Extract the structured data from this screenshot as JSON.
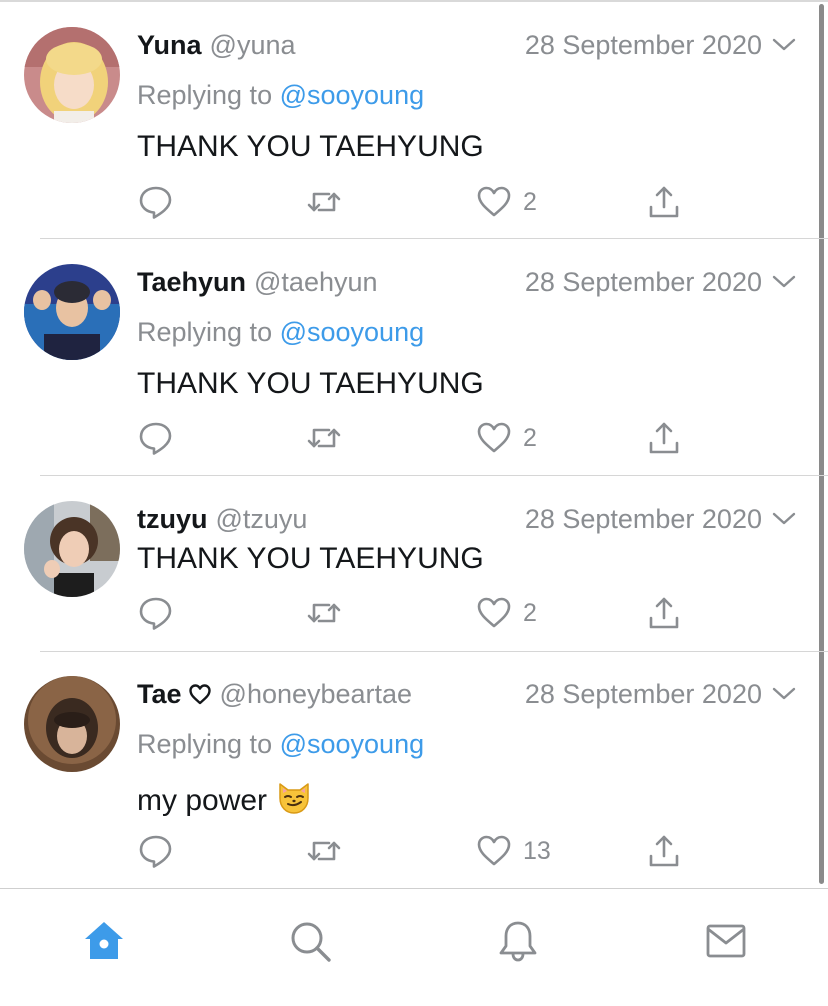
{
  "tweets": [
    {
      "name": "Yuna",
      "handle": "@yuna",
      "date": "28 September 2020",
      "replying_prefix": "Replying to ",
      "replying_to": "@sooyoung",
      "text": "THANK YOU TAEHYUNG",
      "likes": "2"
    },
    {
      "name": "Taehyun",
      "handle": "@taehyun",
      "date": "28 September 2020",
      "replying_prefix": "Replying to ",
      "replying_to": "@sooyoung",
      "text": "THANK YOU TAEHYUNG",
      "likes": "2"
    },
    {
      "name": "tzuyu",
      "handle": "@tzuyu",
      "date": "28 September 2020",
      "text": "THANK YOU TAEHYUNG",
      "likes": "2"
    },
    {
      "name": "Tae",
      "handle": "@honeybeartae",
      "date": "28 September 2020",
      "replying_prefix": "Replying to ",
      "replying_to": "@sooyoung",
      "text": "my power",
      "emoji": "smirking-cat-emoji",
      "likes": "13"
    }
  ],
  "icons": {
    "reply": "reply-icon",
    "retweet": "retweet-icon",
    "like": "heart-icon",
    "share": "share-icon",
    "more": "chevron-down-icon"
  },
  "tabbar": [
    {
      "name": "home",
      "icon": "home-icon",
      "active": true
    },
    {
      "name": "search",
      "icon": "search-icon",
      "active": false
    },
    {
      "name": "notifications",
      "icon": "bell-icon",
      "active": false
    },
    {
      "name": "messages",
      "icon": "mail-icon",
      "active": false
    }
  ],
  "colors": {
    "accent": "#3d9be9",
    "secondary_text": "#8a8d91",
    "primary_text": "#14171a",
    "icon_gray": "#8a8d91"
  }
}
